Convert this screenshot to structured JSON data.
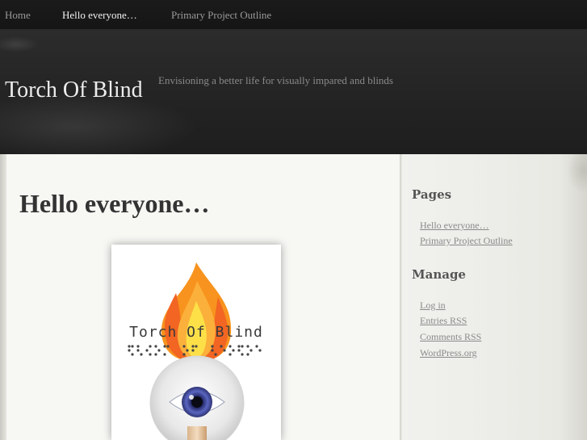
{
  "nav": {
    "items": [
      {
        "label": "Home",
        "active": false
      },
      {
        "label": "Hello everyone…",
        "active": true
      },
      {
        "label": "Primary Project Outline",
        "active": false
      }
    ]
  },
  "header": {
    "title": "Torch Of Blind",
    "tagline": "Envisioning a better life for visually impared and blinds"
  },
  "post": {
    "title": "Hello everyone…",
    "image": {
      "logo_text": "Torch Of Blind",
      "icons": [
        "flame-icon",
        "torch-icon",
        "eye-icon",
        "braille-dots"
      ]
    }
  },
  "sidebar": {
    "pages": {
      "title": "Pages",
      "links": [
        "Hello everyone…",
        "Primary Project Outline"
      ]
    },
    "manage": {
      "title": "Manage",
      "links": [
        "Log in",
        "Entries RSS",
        "Comments RSS",
        "WordPress.org"
      ]
    }
  },
  "colors": {
    "nav_bg": "#181818",
    "header_bg": "#272727",
    "content_bg": "#f7f7f4",
    "sidebar_bg": "#efefeb",
    "link": "#8a8a8a",
    "flame_orange": "#f7931e",
    "flame_yellow": "#fde047",
    "iris_blue": "#4c55a8"
  }
}
